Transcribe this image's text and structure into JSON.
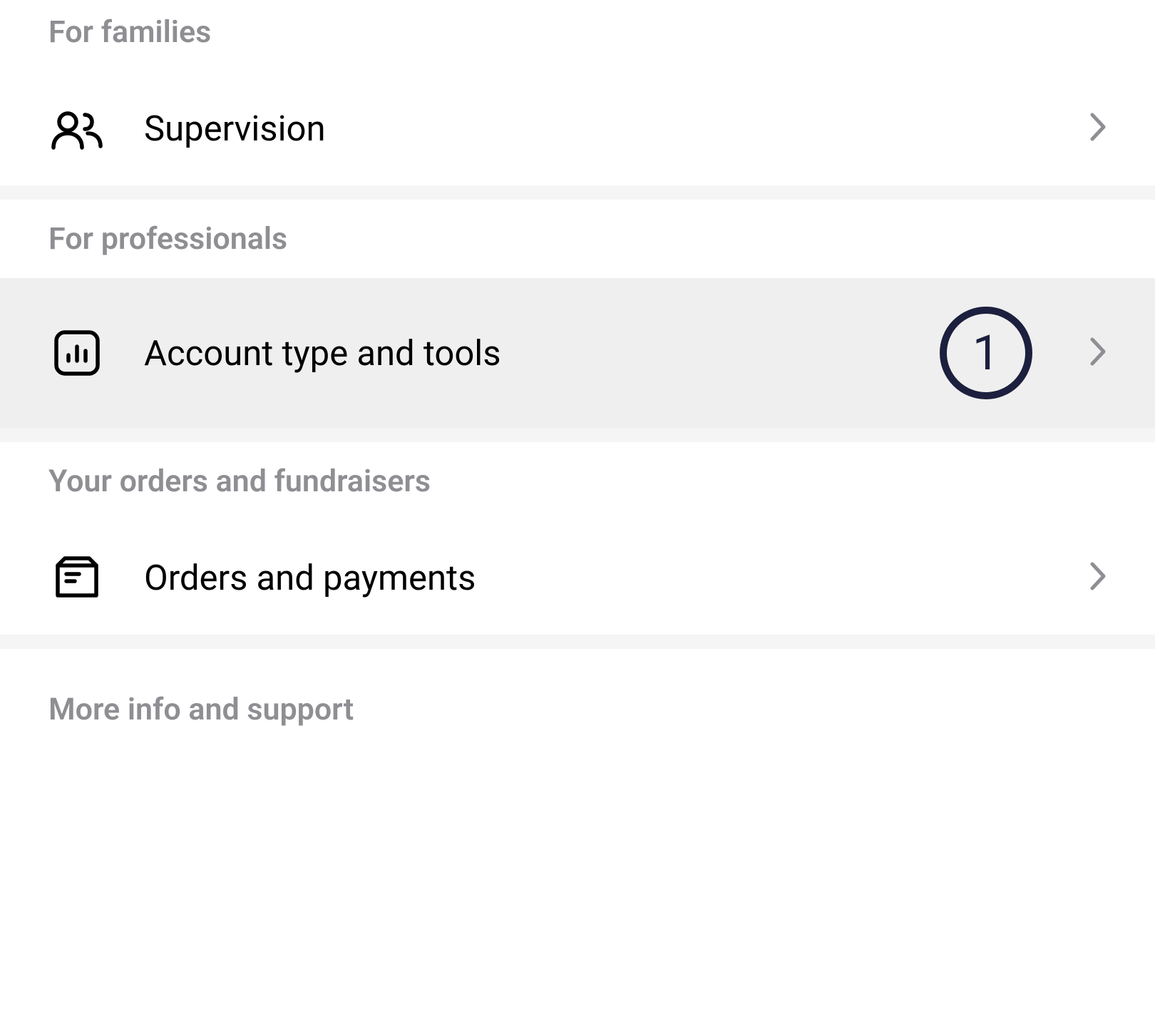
{
  "sections": {
    "families": {
      "header": "For families",
      "items": {
        "supervision": {
          "label": "Supervision"
        }
      }
    },
    "professionals": {
      "header": "For professionals",
      "items": {
        "account_type_tools": {
          "label": "Account type and tools",
          "badge": "1"
        }
      }
    },
    "orders_fundraisers": {
      "header": "Your orders and fundraisers",
      "items": {
        "orders_payments": {
          "label": "Orders and payments"
        }
      }
    },
    "more_info_support": {
      "header": "More info and support"
    }
  },
  "colors": {
    "badge_border": "#1c1f3d",
    "header_text": "#8e8e93",
    "highlight_bg": "#efefef"
  }
}
